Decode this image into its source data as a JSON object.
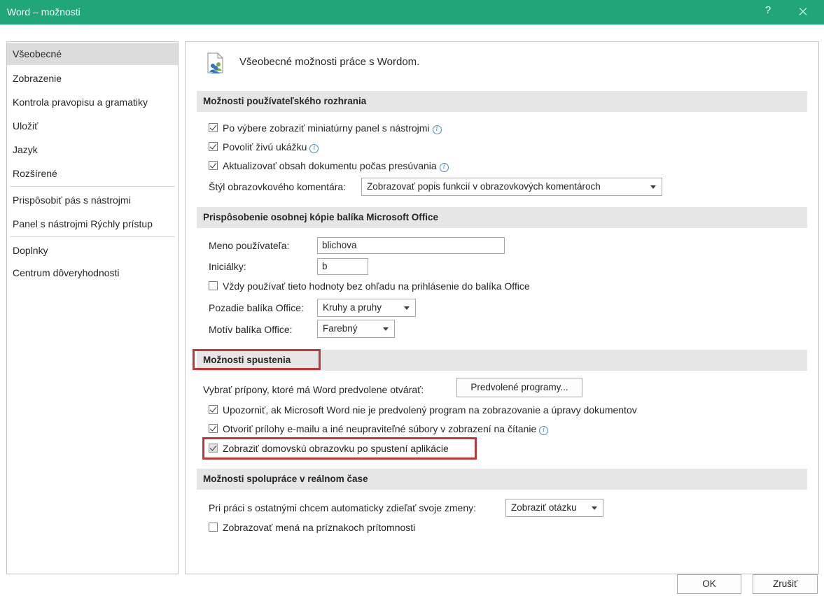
{
  "window": {
    "title": "Word – možnosti",
    "help_label": "?",
    "accent": "#21a67a"
  },
  "sidebar": {
    "items": [
      {
        "label": "Všeobecné"
      },
      {
        "label": "Zobrazenie"
      },
      {
        "label": "Kontrola pravopisu a gramatiky"
      },
      {
        "label": "Uložiť"
      },
      {
        "label": "Jazyk"
      },
      {
        "label": "Rozšírené"
      },
      {
        "label": "Prispôsobiť pás s nástrojmi"
      },
      {
        "label": "Panel s nástrojmi Rýchly prístup"
      },
      {
        "label": "Doplnky"
      },
      {
        "label": "Centrum dôveryhodnosti"
      }
    ]
  },
  "header": {
    "text": "Všeobecné možnosti práce s Wordom.",
    "icon": "general-options-icon"
  },
  "ui_section": {
    "title": "Možnosti používateľského rozhrania",
    "check1": "Po výbere zobraziť miniatúrny panel s nástrojmi",
    "check2": "Povoliť živú ukážku",
    "check3": "Aktualizovať obsah dokumentu počas presúvania",
    "screentip_label": "Štýl obrazovkového komentára:",
    "screentip_value": "Zobrazovať popis funkcií v obrazovkových komentároch"
  },
  "personalize_section": {
    "title": "Prispôsobenie osobnej kópie balíka Microsoft Office",
    "username_label": "Meno používateľa:",
    "username_value": "blichova",
    "initials_label": "Iniciálky:",
    "initials_value": "b",
    "always_use_label": "Vždy používať tieto hodnoty bez ohľadu na prihlásenie do balíka Office",
    "background_label": "Pozadie balíka Office:",
    "background_value": "Kruhy a pruhy",
    "theme_label": "Motív balíka Office:",
    "theme_value": "Farebný"
  },
  "startup_section": {
    "title": "Možnosti spustenia",
    "extensions_label": "Vybrať prípony, ktoré má Word predvolene otvárať:",
    "default_programs_button": "Predvolené programy...",
    "check_default": "Upozorniť, ak Microsoft Word nie je predvolený program na zobrazovanie a úpravy dokumentov",
    "check_reading": "Otvoriť prílohy e-mailu a iné neupraviteľné súbory v zobrazení na čítanie",
    "check_start_screen": "Zobraziť domovskú obrazovku po spustení aplikácie",
    "highlight_color": "#b83b3b"
  },
  "coauthoring_section": {
    "title": "Možnosti spolupráce v reálnom čase",
    "share_label": "Pri práci s ostatnými chcem automaticky zdieľať svoje zmeny:",
    "share_value": "Zobraziť otázku",
    "check_names": "Zobrazovať mená na príznakoch prítomnosti"
  },
  "footer": {
    "ok_label": "OK",
    "cancel_label": "Zrušiť"
  }
}
